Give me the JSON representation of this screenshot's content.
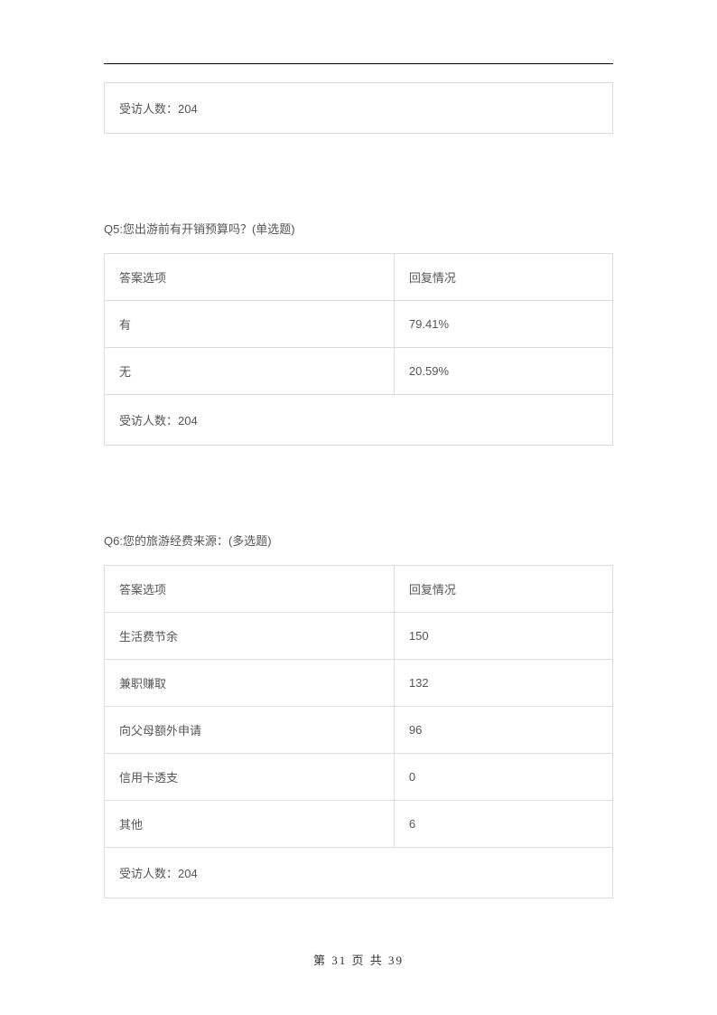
{
  "top_summary": {
    "prefix": "受访人数：",
    "value": "204"
  },
  "q5": {
    "title": "Q5:您出游前有开销预算吗？(单选题)",
    "header_left": "答案选项",
    "header_right": "回复情况",
    "rows": [
      {
        "label": "有",
        "value": "79.41%"
      },
      {
        "label": "无",
        "value": "20.59%"
      }
    ],
    "footer_prefix": "受访人数：",
    "footer_value": "204"
  },
  "q6": {
    "title": "Q6:您的旅游经费来源：(多选题)",
    "header_left": "答案选项",
    "header_right": "回复情况",
    "rows": [
      {
        "label": "生活费节余",
        "value": "150"
      },
      {
        "label": "兼职赚取",
        "value": "132"
      },
      {
        "label": "向父母额外申请",
        "value": "96"
      },
      {
        "label": "信用卡透支",
        "value": "0"
      },
      {
        "label": "其他",
        "value": "6"
      }
    ],
    "footer_prefix": "受访人数：",
    "footer_value": "204"
  },
  "page_footer": {
    "text": "第 31 页 共 39"
  }
}
